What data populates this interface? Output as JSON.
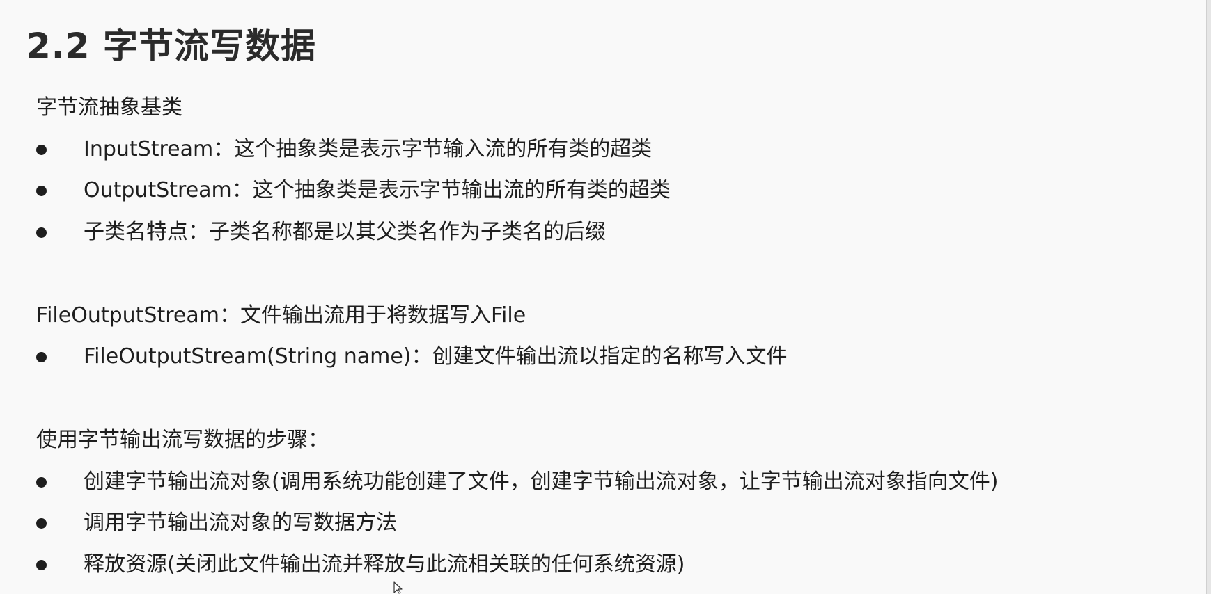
{
  "title": "2.2 字节流写数据",
  "section1": {
    "heading": "字节流抽象基类",
    "items": [
      "InputStream：这个抽象类是表示字节输入流的所有类的超类",
      "OutputStream：这个抽象类是表示字节输出流的所有类的超类",
      "子类名特点：子类名称都是以其父类名作为子类名的后缀"
    ]
  },
  "section2": {
    "heading": "FileOutputStream：文件输出流用于将数据写入File",
    "items": [
      "FileOutputStream(String name)：创建文件输出流以指定的名称写入文件"
    ]
  },
  "section3": {
    "heading": "使用字节输出流写数据的步骤：",
    "items": [
      "创建字节输出流对象(调用系统功能创建了文件，创建字节输出流对象，让字节输出流对象指向文件)",
      "调用字节输出流对象的写数据方法",
      "释放资源(关闭此文件输出流并释放与此流相关联的任何系统资源)"
    ]
  }
}
